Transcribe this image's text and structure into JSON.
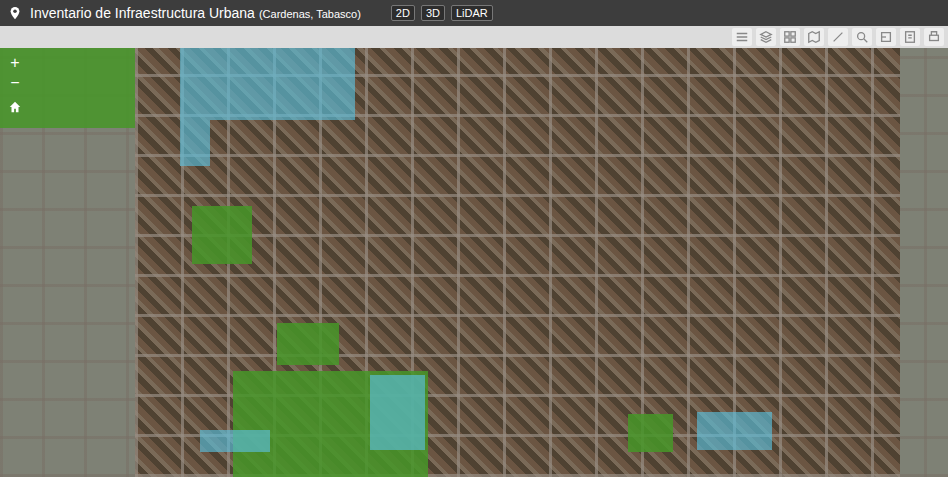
{
  "header": {
    "title": "Inventario de Infraestructura Urbana",
    "subtitle": "(Cardenas, Tabasco)",
    "view_buttons": [
      {
        "label": "2D"
      },
      {
        "label": "3D"
      },
      {
        "label": "LiDAR"
      }
    ]
  },
  "zoom": {
    "in": "+",
    "out": "−"
  }
}
